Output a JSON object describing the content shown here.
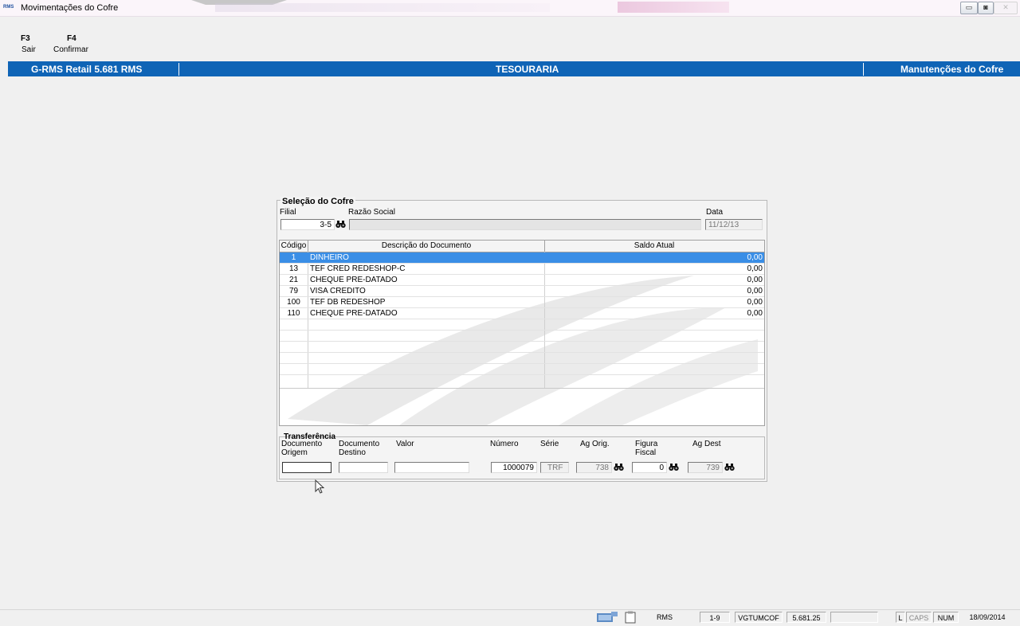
{
  "window": {
    "title": "Movimentações do Cofre",
    "logo": "RMS",
    "buttons": [
      "minimize-icon",
      "maximize-icon",
      "close-icon"
    ]
  },
  "fkeys": [
    {
      "key": "F3",
      "label": "Sair"
    },
    {
      "key": "F4",
      "label": "Confirmar"
    }
  ],
  "header": {
    "left": "G-RMS Retail 5.681 RMS",
    "center": "TESOURARIA",
    "right": "Manutenções do Cofre"
  },
  "selecao": {
    "legend": "Seleção do Cofre",
    "filial_label": "Filial",
    "filial_value": "3-5",
    "razao_label": "Razão Social",
    "razao_value": "",
    "data_label": "Data",
    "data_value": "11/12/13"
  },
  "table": {
    "columns": [
      "Código",
      "Descrição do Documento",
      "Saldo Atual"
    ],
    "rows": [
      {
        "codigo": "1",
        "descricao": "DINHEIRO",
        "saldo": "0,00",
        "selected": true
      },
      {
        "codigo": "13",
        "descricao": "TEF CRED REDESHOP-C",
        "saldo": "0,00"
      },
      {
        "codigo": "21",
        "descricao": "CHEQUE PRE-DATADO",
        "saldo": "0,00"
      },
      {
        "codigo": "79",
        "descricao": "VISA CREDITO",
        "saldo": "0,00"
      },
      {
        "codigo": "100",
        "descricao": "TEF DB REDESHOP",
        "saldo": "0,00"
      },
      {
        "codigo": "110",
        "descricao": "CHEQUE PRE-DATADO",
        "saldo": "0,00"
      }
    ]
  },
  "transferencia": {
    "legend": "Transferência",
    "doc_origem_label1": "Documento",
    "doc_origem_label2": "Origem",
    "doc_destino_label1": "Documento",
    "doc_destino_label2": "Destino",
    "valor_label": "Valor",
    "numero_label": "Número",
    "numero_value": "1000079",
    "serie_label": "Série",
    "serie_value": "TRF",
    "ag_orig_label": "Ag Orig.",
    "ag_orig_value": "738",
    "figura_label1": "Figura",
    "figura_label2": "Fiscal",
    "figura_value": "0",
    "ag_dest_label": "Ag Dest",
    "ag_dest_value": "739"
  },
  "statusbar": {
    "items": [
      "RMS",
      "1-9",
      "VGTUMCOF",
      "5.681.25",
      "",
      "L",
      "CAPS",
      "NUM",
      "18/09/2014"
    ]
  }
}
